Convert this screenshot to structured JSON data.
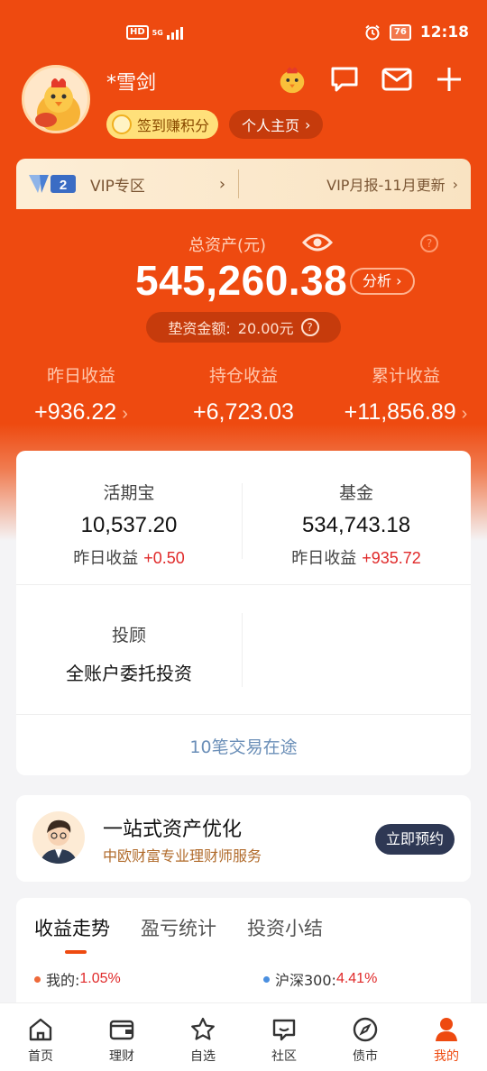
{
  "status_bar": {
    "hd": "HD",
    "network": "5G",
    "battery": "76",
    "time": "12:18"
  },
  "profile": {
    "username": "*雪剑",
    "checkin_label": "签到赚积分",
    "homepage_label": "个人主页",
    "homepage_chevron": "›"
  },
  "vip": {
    "title": "VIP专区",
    "chevron": "›",
    "report": "VIP月报-11月更新",
    "report_chevron": "›",
    "logo_text": "2"
  },
  "assets": {
    "label": "总资产(元)",
    "help": "?",
    "total": "545,260.38",
    "analysis": "分析 ›",
    "advance_label": "垫资金额:",
    "advance_value": "20.00元",
    "advance_help": "?"
  },
  "income": [
    {
      "label": "昨日收益",
      "value": "+936.22",
      "chevron": "›"
    },
    {
      "label": "持仓收益",
      "value": "+6,723.03",
      "chevron": ""
    },
    {
      "label": "累计收益",
      "value": "+11,856.89",
      "chevron": "›"
    }
  ],
  "accounts": {
    "items": [
      {
        "name": "活期宝",
        "value": "10,537.20",
        "yesterday_label": "昨日收益",
        "yesterday_value": "+0.50"
      },
      {
        "name": "基金",
        "value": "534,743.18",
        "yesterday_label": "昨日收益",
        "yesterday_value": "+935.72"
      }
    ],
    "advisor_name": "投顾",
    "advisor_desc": "全账户委托投资",
    "in_flight": "10笔交易在途"
  },
  "advisor_card": {
    "title": "一站式资产优化",
    "subtitle": "中欧财富专业理财师服务",
    "button": "立即预约"
  },
  "trend": {
    "tabs": [
      "收益走势",
      "盈亏统计",
      "投资小结"
    ],
    "legend": [
      {
        "label": "我的:",
        "value": "1.05%",
        "color": "#ee6a3a"
      },
      {
        "label": "沪深300:",
        "value": "4.41%",
        "color": "#4a8fe0"
      }
    ]
  },
  "nav": [
    {
      "label": "首页",
      "icon": "home-icon"
    },
    {
      "label": "理财",
      "icon": "wallet-icon"
    },
    {
      "label": "自选",
      "icon": "star-icon"
    },
    {
      "label": "社区",
      "icon": "chat-icon"
    },
    {
      "label": "债市",
      "icon": "compass-icon"
    },
    {
      "label": "我的",
      "icon": "user-icon",
      "active": true
    }
  ],
  "colors": {
    "brand": "#ee4a10",
    "profit": "#e02a2a",
    "link": "#6b8fb8",
    "dark_button": "#2e3854"
  }
}
